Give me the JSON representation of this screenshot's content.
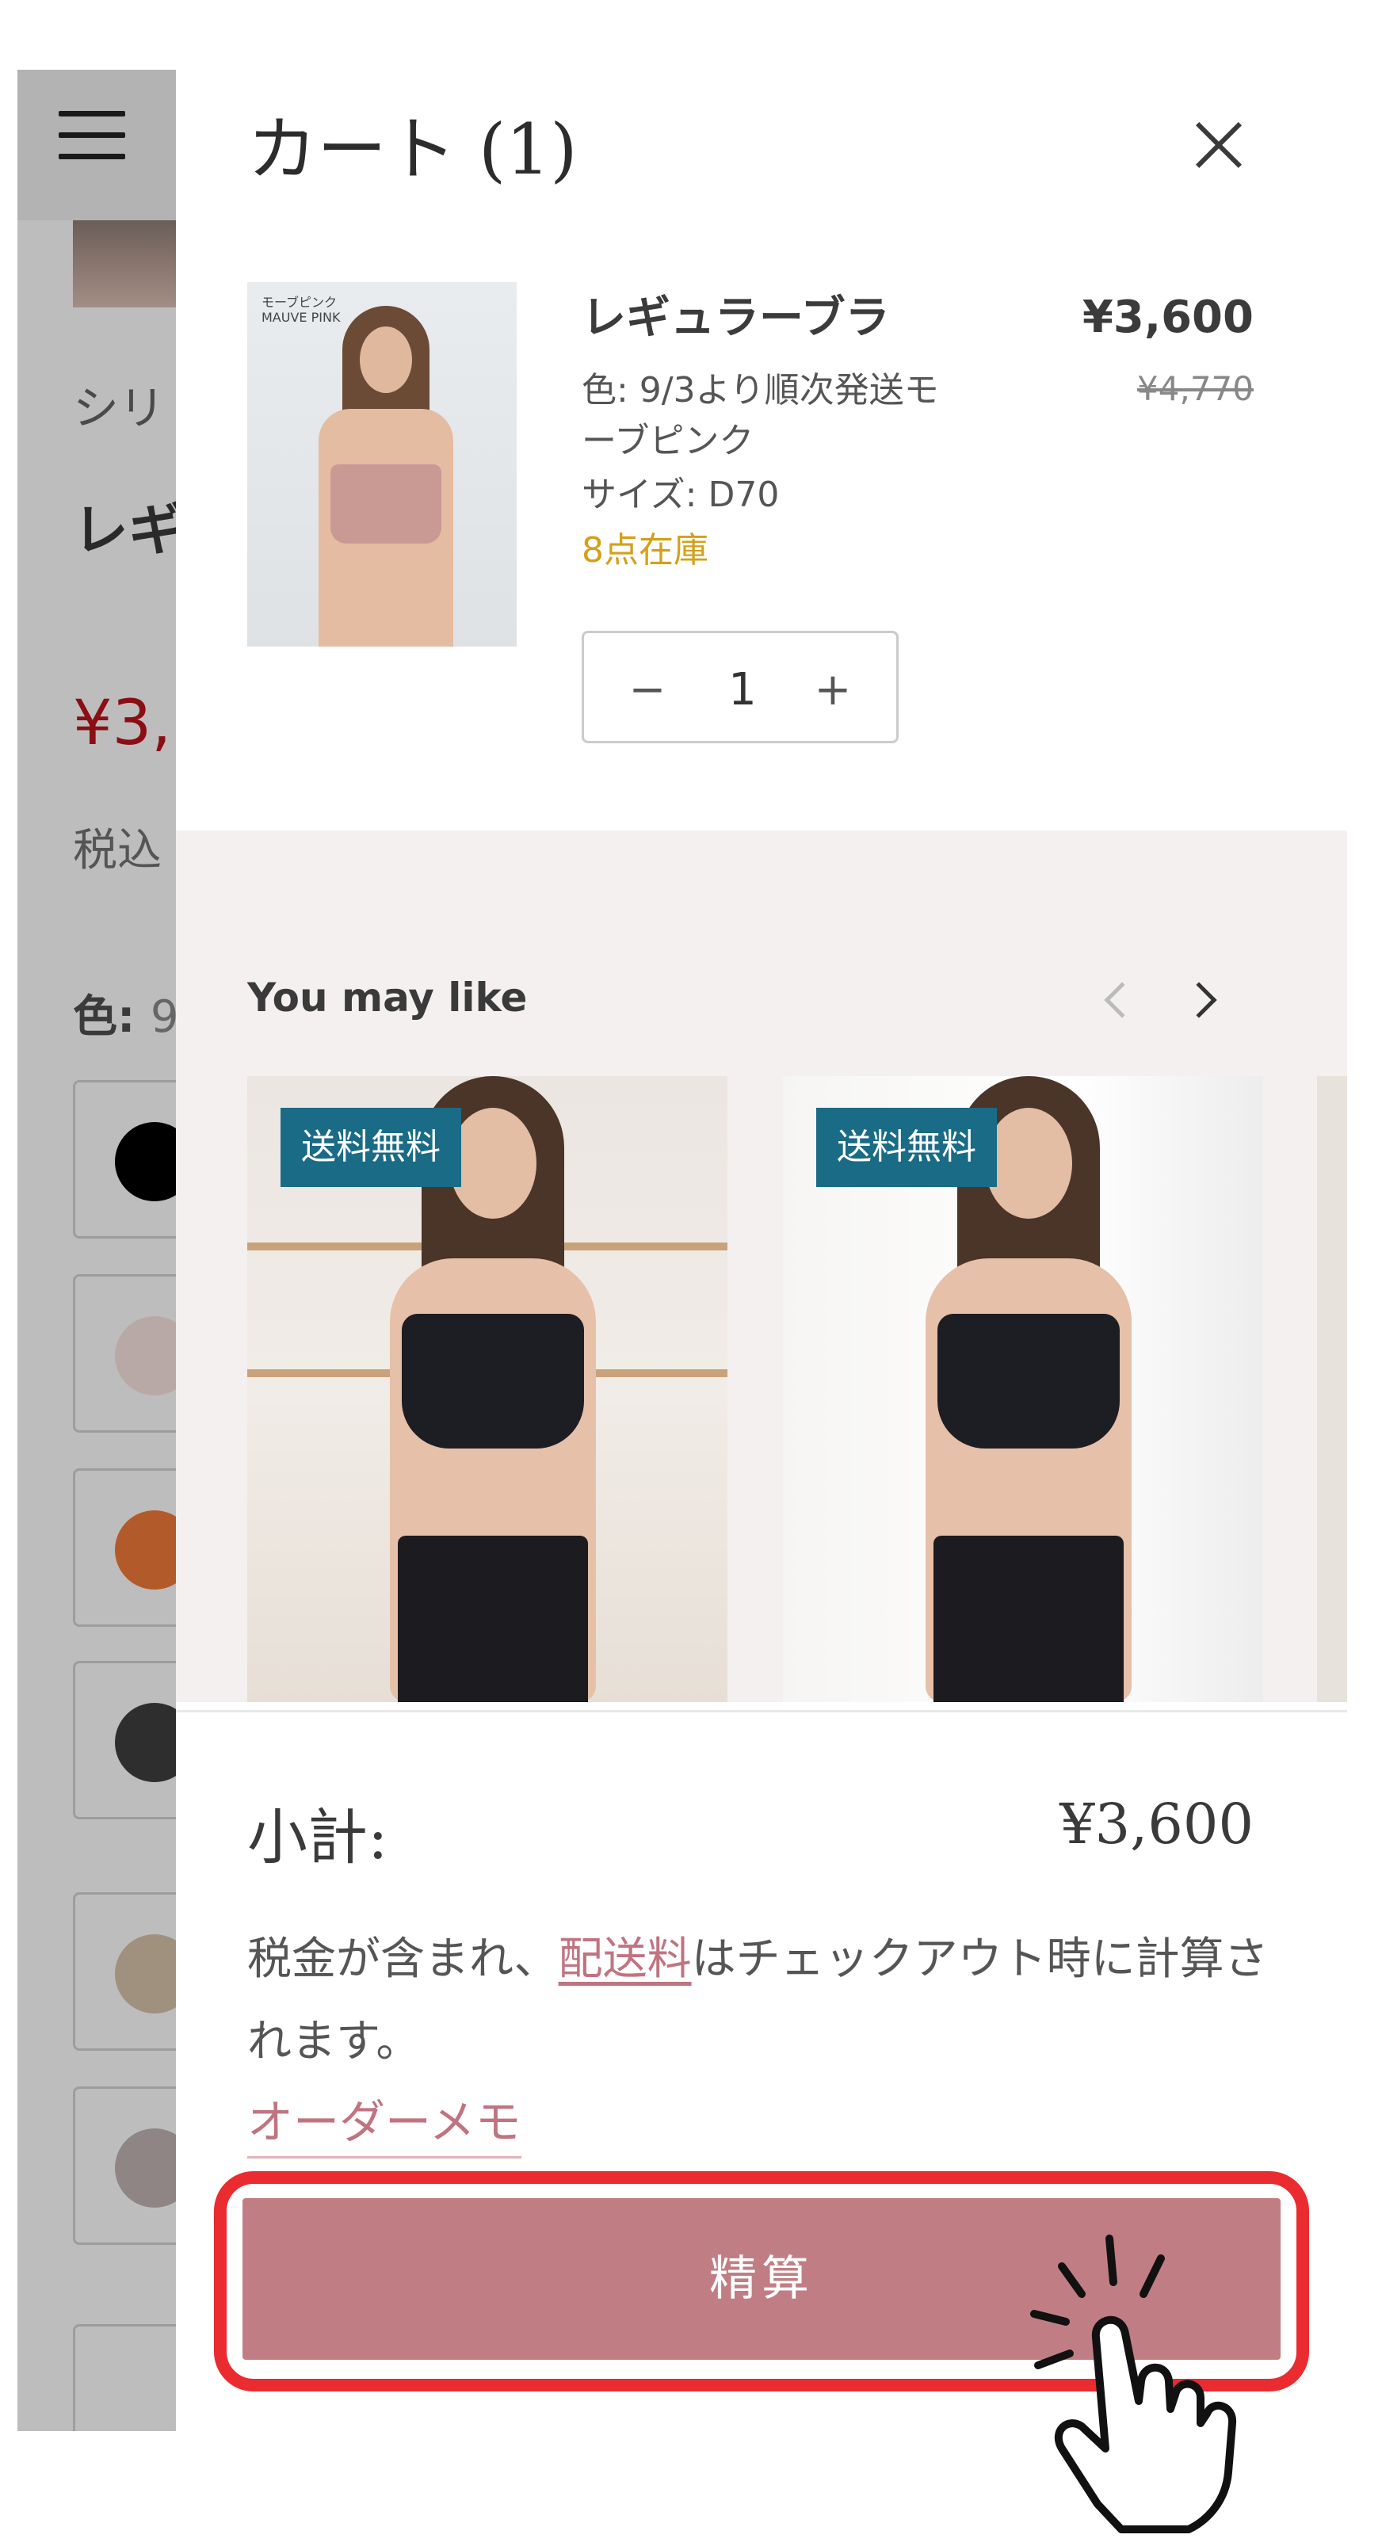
{
  "background_page": {
    "series_label": "シリ",
    "title_fragment": "レギ",
    "price_fragment": "¥3,",
    "tax_fragment": "税込",
    "color_label": "色:",
    "color_value_fragment": "9",
    "swatch_colors": [
      "#000000",
      "#b9a9a6",
      "#b35a2b",
      "#2e2e2e",
      "#a0917f",
      "#8f8585"
    ]
  },
  "cart": {
    "title": "カート (1)",
    "item": {
      "image_label_jp": "モーブピンク",
      "image_label_en": "MAUVE PINK",
      "name": "レギュラーブラ",
      "price": "¥3,600",
      "compare_price": "¥4,770",
      "color_line1": "色: 9/3より順次発送モ",
      "color_line2": "ーブピンク",
      "size": "サイズ: D70",
      "stock": "8点在庫",
      "quantity": "1",
      "minus": "−",
      "plus": "+"
    },
    "recommendations": {
      "title": "You may like",
      "products": [
        {
          "badge": "送料無料"
        },
        {
          "badge": "送料無料"
        }
      ]
    },
    "footer": {
      "subtotal_label": "小計:",
      "subtotal_value": "¥3,600",
      "tax_note_before": "税金が含まれ、",
      "tax_note_link": "配送料",
      "tax_note_after": "はチェックアウト時に計算されます。",
      "order_memo": "オーダーメモ",
      "checkout": "精算"
    }
  }
}
